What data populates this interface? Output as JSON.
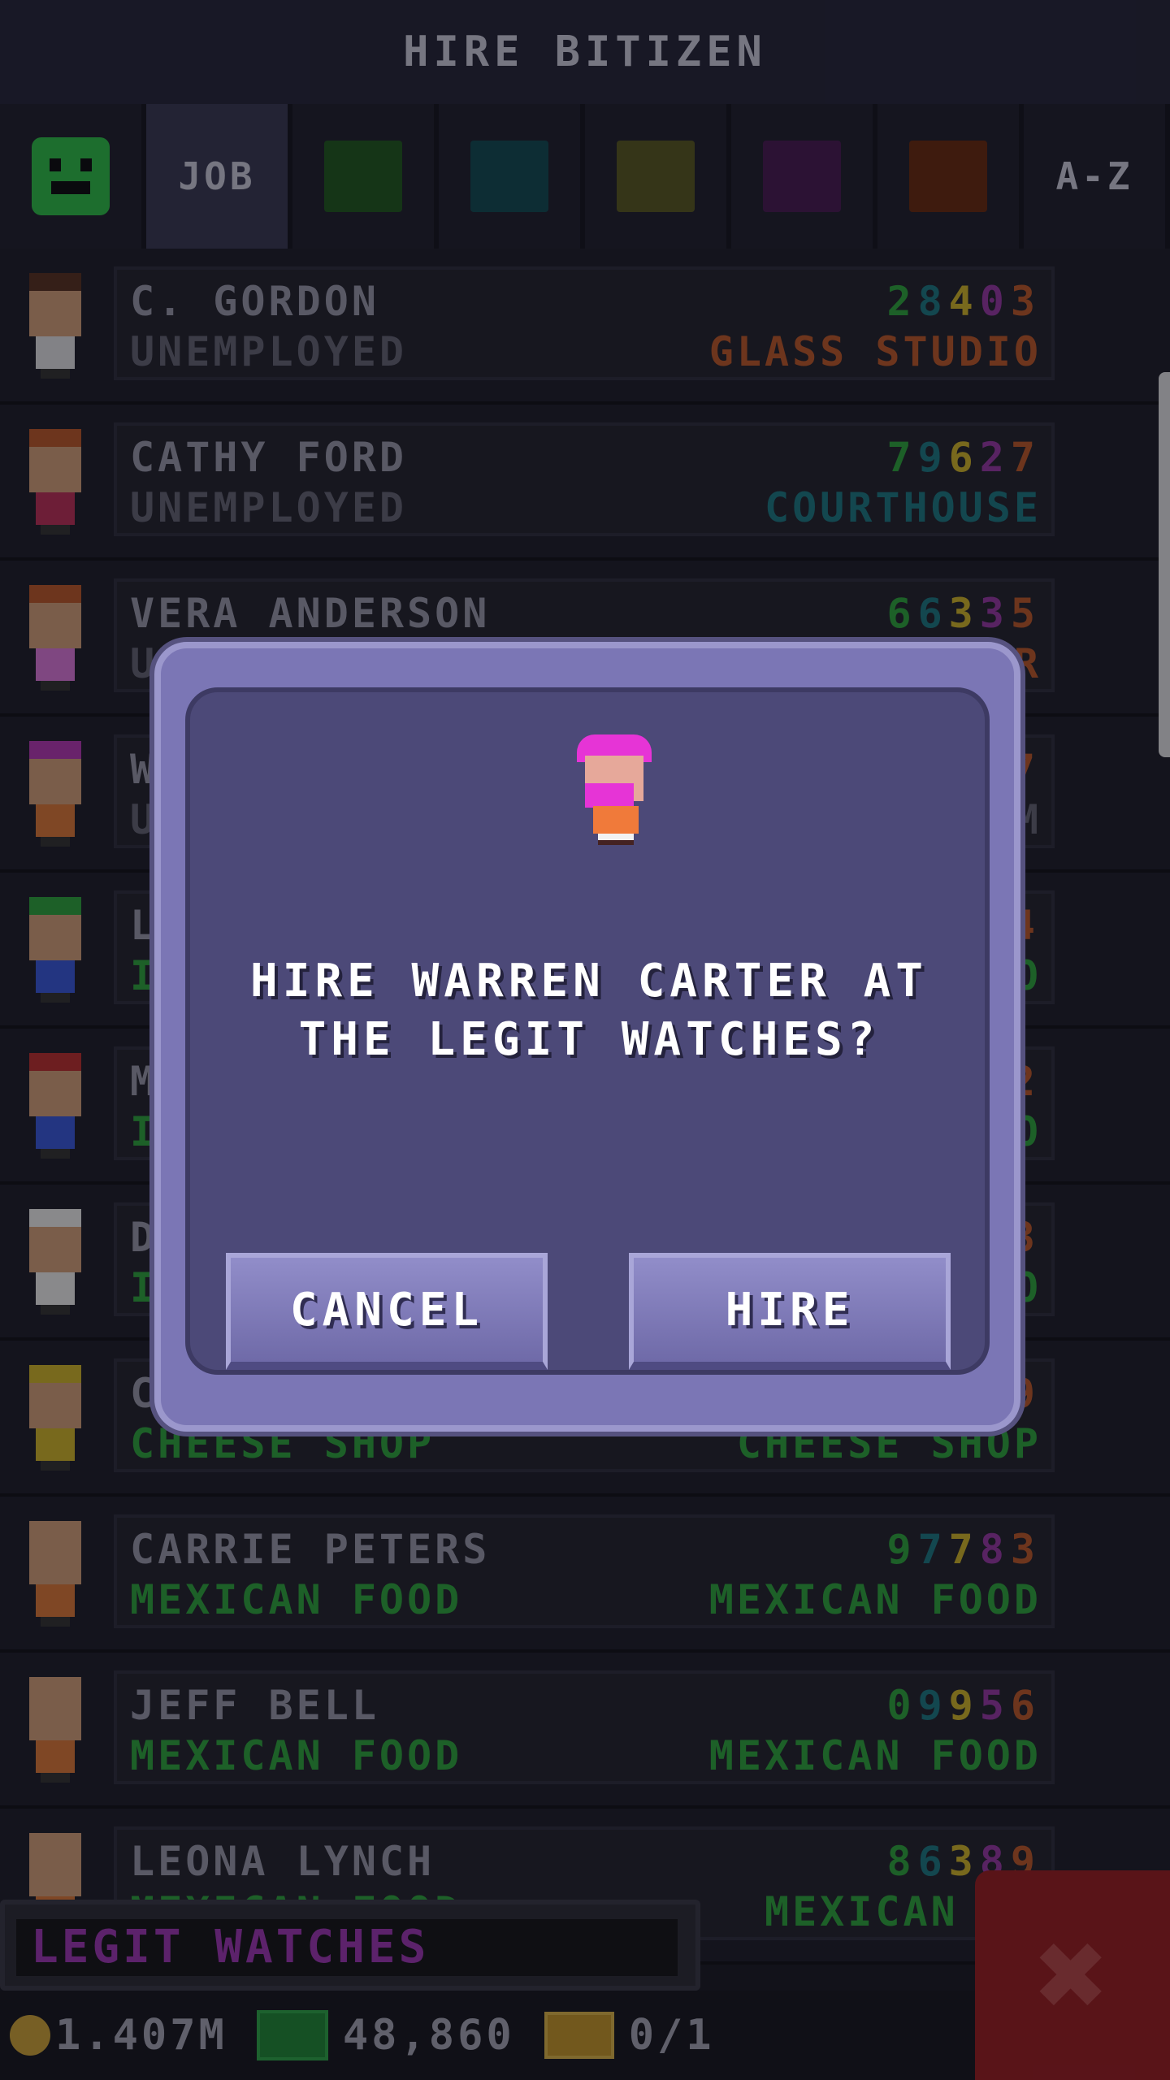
{
  "header": {
    "title": "HIRE BITIZEN"
  },
  "tabs": [
    {
      "kind": "face",
      "icon": "happy-face-icon",
      "color": "#2fc24a"
    },
    {
      "kind": "label",
      "label": "JOB"
    },
    {
      "kind": "swatch",
      "color": "#1f5a1f"
    },
    {
      "kind": "swatch",
      "color": "#124b55"
    },
    {
      "kind": "swatch",
      "color": "#5a5a22"
    },
    {
      "kind": "swatch",
      "color": "#4a1a55"
    },
    {
      "kind": "swatch",
      "color": "#6a2a10"
    },
    {
      "kind": "label",
      "label": "A-Z"
    }
  ],
  "rows": [
    {
      "name": "C. GORDON",
      "status": "UNEMPLOYED",
      "status_color": "#666677",
      "stats": [
        "2",
        "8",
        "4",
        "0",
        "3"
      ],
      "dest": "GLASS STUDIO",
      "dest_color": "#c05a2a",
      "mood": "sad",
      "hair": "#5a3222",
      "shirt": "#e6e6ea"
    },
    {
      "name": "CATHY FORD",
      "status": "UNEMPLOYED",
      "status_color": "#666677",
      "stats": [
        "7",
        "9",
        "6",
        "2",
        "7"
      ],
      "dest": "COURTHOUSE",
      "dest_color": "#1d7a86",
      "mood": "sad",
      "hair": "#c05a2a",
      "shirt": "#c0305a"
    },
    {
      "name": "VERA ANDERSON",
      "status": "UNEMPLOYED",
      "status_color": "#666677",
      "stats": [
        "6",
        "6",
        "3",
        "3",
        "5"
      ],
      "dest": "R",
      "dest_color": "#c05a2a",
      "mood": "sad",
      "hair": "#c05a2a",
      "shirt": "#e07ae0"
    },
    {
      "name": "W",
      "status": "U",
      "status_color": "#666677",
      "stats": [
        "",
        "",
        "",
        "",
        "7"
      ],
      "dest": "M",
      "dest_color": "#666677",
      "mood": "sad",
      "hair": "#b83ab8",
      "shirt": "#e07a3a"
    },
    {
      "name": "L",
      "status": "IT",
      "status_color": "#2fa83e",
      "stats": [
        "",
        "",
        "",
        "",
        "4"
      ],
      "dest": "O",
      "dest_color": "#2fa83e",
      "mood": "happy",
      "hair": "#2fa83e",
      "shirt": "#3a5ae0"
    },
    {
      "name": "M",
      "status": "IT",
      "status_color": "#2fa83e",
      "stats": [
        "",
        "",
        "",
        "",
        "2"
      ],
      "dest": "O",
      "dest_color": "#2fa83e",
      "mood": "happy",
      "hair": "#c03030",
      "shirt": "#3a5ae0"
    },
    {
      "name": "D",
      "status": "IT",
      "status_color": "#2fa83e",
      "stats": [
        "",
        "",
        "",
        "",
        "3"
      ],
      "dest": "O",
      "dest_color": "#2fa83e",
      "mood": "happy",
      "hair": "#f2f2f2",
      "shirt": "#f2f2f2"
    },
    {
      "name": "C",
      "status": "CHEESE SHOP",
      "status_color": "#2fa83e",
      "stats": [
        "",
        "",
        "",
        "",
        "9"
      ],
      "dest": "CHEESE SHOP",
      "dest_color": "#2fa83e",
      "mood": "happy",
      "hair": "#d4b82a",
      "shirt": "#d4b82a"
    },
    {
      "name": "CARRIE PETERS",
      "status": "MEXICAN FOOD",
      "status_color": "#2fa83e",
      "stats": [
        "9",
        "7",
        "7",
        "8",
        "3"
      ],
      "dest": "MEXICAN FOOD",
      "dest_color": "#2fa83e",
      "mood": "happy",
      "hair": "#d8a27c",
      "shirt": "#e07a3a"
    },
    {
      "name": "JEFF BELL",
      "status": "MEXICAN FOOD",
      "status_color": "#2fa83e",
      "stats": [
        "0",
        "9",
        "9",
        "5",
        "6"
      ],
      "dest": "MEXICAN FOOD",
      "dest_color": "#2fa83e",
      "mood": "happy",
      "hair": "#d8a27c",
      "shirt": "#e07a3a"
    },
    {
      "name": "LEONA LYNCH",
      "status": "MEXICAN FOOD",
      "status_color": "#2fa83e",
      "stats": [
        "8",
        "6",
        "3",
        "8",
        "9"
      ],
      "dest": "MEXICAN FO",
      "dest_color": "#2fa83e",
      "mood": "happy",
      "hair": "#d8a27c",
      "shirt": "#e07a3a"
    }
  ],
  "stat_colors": [
    "#2fa83e",
    "#1d7a86",
    "#d4b82a",
    "#9a3aa8",
    "#c05a2a"
  ],
  "bottom": {
    "building": "LEGIT WATCHES",
    "coins": "1.407M",
    "bux": "48,860",
    "chests": "0/1",
    "close_icon": "close-x-icon"
  },
  "dialog": {
    "question": "HIRE WARREN CARTER AT THE LEGIT WATCHES?",
    "cancel_label": "CANCEL",
    "hire_label": "HIRE"
  }
}
